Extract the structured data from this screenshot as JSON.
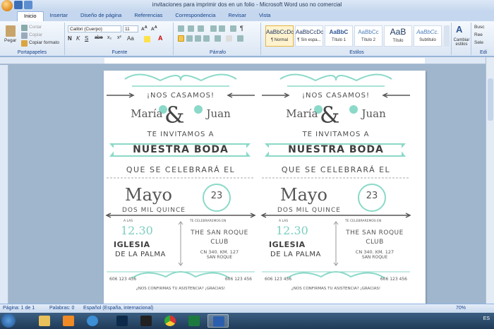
{
  "window": {
    "title": "invitaciones para imprimir dos en un folio - Microsoft Word uso no comercial"
  },
  "tabs": [
    "Inicio",
    "Insertar",
    "Diseño de página",
    "Referencias",
    "Correspondencia",
    "Revisar",
    "Vista"
  ],
  "ribbon": {
    "clipboard": {
      "paste": "Pegar",
      "cut": "Cortar",
      "copy": "Copiar",
      "format_painter": "Copiar formato",
      "label": "Portapapeles"
    },
    "font": {
      "name": "Calibri (Cuerpo)",
      "size": "11",
      "label": "Fuente"
    },
    "paragraph": {
      "label": "Párrafo"
    },
    "styles": {
      "label": "Estilos",
      "items": [
        {
          "sample": "AaBbCcDc",
          "name": "¶ Normal"
        },
        {
          "sample": "AaBbCcDc",
          "name": "¶ Sin espa..."
        },
        {
          "sample": "AaBbC",
          "name": "Título 1"
        },
        {
          "sample": "AaBbCc",
          "name": "Título 2"
        },
        {
          "sample": "AaB",
          "name": "Título"
        },
        {
          "sample": "AaBbCc.",
          "name": "Subtítulo"
        }
      ],
      "change_styles": "Cambiar estilos"
    },
    "editing": {
      "find": "Busc",
      "replace": "Ree",
      "select": "Sele",
      "label": "Edi"
    }
  },
  "invitation": {
    "casamos": "¡NOS CASAMOS!",
    "name1": "María",
    "amp": "&",
    "name2": "Juan",
    "invitamos": "TE INVITAMOS A",
    "boda": "NUESTRA BODA",
    "celebrara": "QUE SE CELEBRARÁ EL",
    "month": "Mayo",
    "day": "23",
    "year": "DOS MIL QUINCE",
    "a_las": "A LAS",
    "time": "12.30",
    "iglesia": "IGLESIA",
    "palma": "DE LA PALMA",
    "celebraremos": "TE CELEBRAREMOS EN",
    "club_line1": "THE SAN ROQUE",
    "club_line2": "CLUB",
    "address1": "CN 340. KM. 127",
    "address2": "SAN ROQUE",
    "phone_left": "606 123 456",
    "phone_right": "606 123 456",
    "confirm": "¿NOS CONFIRMAS TU ASISTENCIA? ¡GRACIAS!",
    "gracias": "¡GRACIAS!"
  },
  "colors": {
    "accent": "#8bd9c8",
    "accent_dark": "#7ccfc0"
  },
  "statusbar": {
    "page": "Página: 1 de 1",
    "words": "Palabras: 0",
    "language": "Español (España, internacional)",
    "zoom": "70%"
  },
  "taskbar": {
    "language": "ES"
  }
}
